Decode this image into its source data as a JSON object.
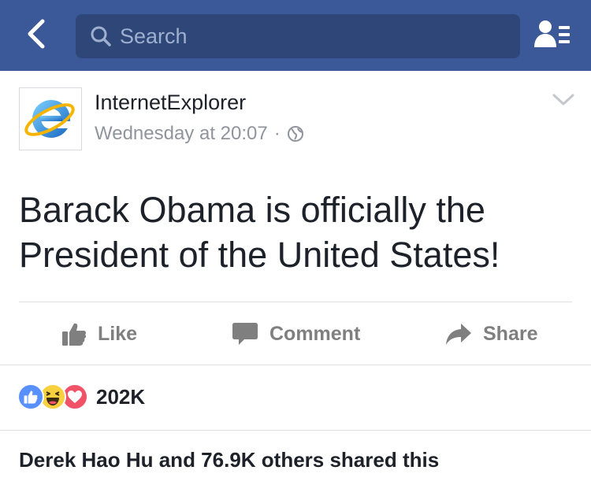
{
  "navbar": {
    "background": "#3b5998",
    "back_icon": "chevron-left-icon",
    "search_icon": "search-icon",
    "search_placeholder": "Search",
    "search_value": "",
    "friends_icon": "friend-requests-icon"
  },
  "post": {
    "page_name": "InternetExplorer",
    "timestamp": "Wednesday at 20:07",
    "separator": "·",
    "privacy_icon": "globe-icon",
    "avatar_icon": "internet-explorer-logo",
    "menu_icon": "chevron-down-icon",
    "text_line1": "Barack Obama is officially the",
    "text_line2": "President of the United States!"
  },
  "actions": {
    "like_label": "Like",
    "comment_label": "Comment",
    "share_label": "Share"
  },
  "reactions": {
    "icons": [
      "like-reaction-icon",
      "haha-reaction-icon",
      "love-reaction-icon"
    ],
    "count": "202K"
  },
  "shares": {
    "text": "Derek Hao Hu and 76.9K others shared this"
  },
  "colors": {
    "brand_blue": "#3b5998",
    "search_bg": "#2e4778",
    "muted_text": "#90949c",
    "action_gray": "#7f7f7f",
    "like_blue": "#5890ff",
    "haha_yellow": "#f7d040",
    "love_red": "#f25268"
  }
}
